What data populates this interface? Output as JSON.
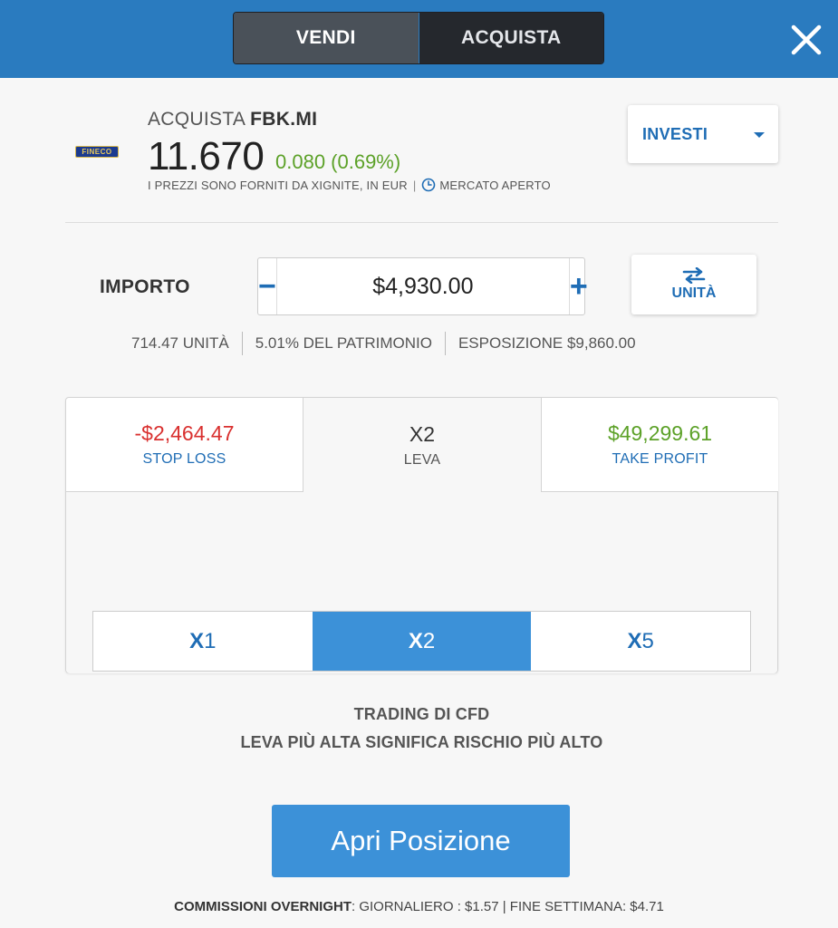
{
  "header": {
    "sell_label": "VENDI",
    "buy_label": "ACQUISTA",
    "selected": "sell",
    "close_icon": "close-icon"
  },
  "instrument": {
    "logo_text": "FINECO",
    "action": "ACQUISTA",
    "symbol": "FBK.MI",
    "price": "11.670",
    "change": "0.080 (0.69%)",
    "source_note": "I PREZZI SONO FORNITI DA XIGNITE, IN EUR",
    "market_status": "MERCATO APERTO",
    "market_icon": "clock-icon"
  },
  "invest_dropdown": {
    "label": "INVESTI",
    "icon": "chevron-down-icon"
  },
  "amount": {
    "label": "IMPORTO",
    "value": "$4,930.00",
    "minus": "−",
    "plus": "+",
    "units_button_label": "UNITÀ",
    "units_button_icon": "swap-arrows-icon"
  },
  "stats": {
    "units": "714.47 UNITÀ",
    "equity": "5.01% DEL PATRIMONIO",
    "exposure": "ESPOSIZIONE $9,860.00"
  },
  "risk": {
    "stop_loss": {
      "value": "-$2,464.47",
      "label": "STOP LOSS"
    },
    "leverage": {
      "value": "X2",
      "label": "LEVA"
    },
    "take_profit": {
      "value": "$49,299.61",
      "label": "TAKE PROFIT"
    }
  },
  "leverage_options": [
    {
      "prefix": "X",
      "num": "1"
    },
    {
      "prefix": "X",
      "num": "2"
    },
    {
      "prefix": "X",
      "num": "5"
    }
  ],
  "leverage_selected": "X2",
  "warning": {
    "line1": "TRADING DI CFD",
    "line2": "LEVA PIÙ ALTA SIGNIFICA RISCHIO PIÙ ALTO"
  },
  "open_button_label": "Apri Posizione",
  "footer": {
    "bold": "COMMISSIONI OVERNIGHT",
    "rest": ": GIORNALIERO : $1.57 | FINE SETTIMANA: $4.71"
  },
  "colors": {
    "header_bg": "#2a7bbf",
    "accent_blue": "#3c91d8",
    "link_blue": "#1f6db5",
    "loss_red": "#d9302f",
    "gain_green": "#5ca128"
  }
}
